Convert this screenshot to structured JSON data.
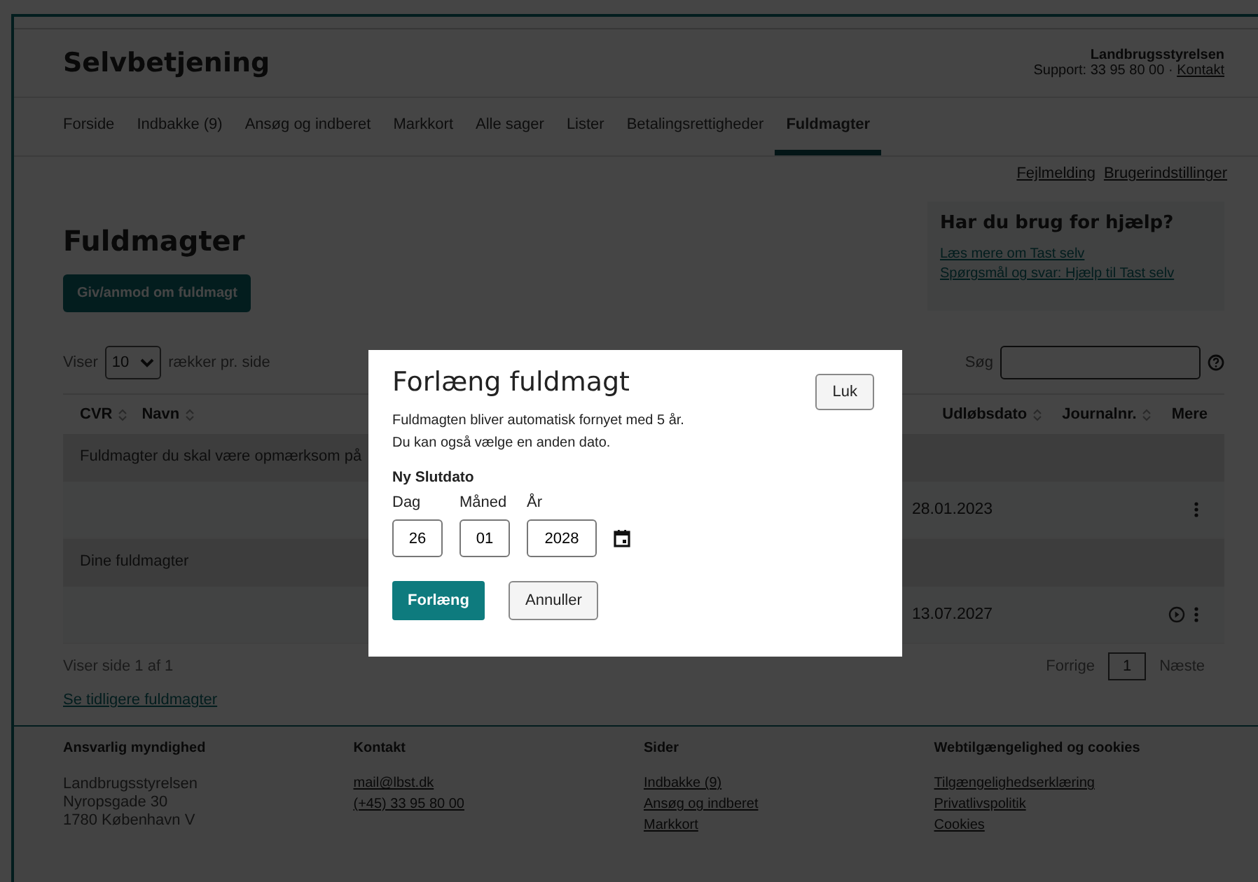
{
  "header": {
    "site_title": "Selvbetjening",
    "org": "Landbrugsstyrelsen",
    "support": "Support: 33 95 80 00 ·",
    "contact_link": "Kontakt"
  },
  "nav": [
    {
      "label": "Forside",
      "selected": false
    },
    {
      "label": "Indbakke (9)",
      "selected": false
    },
    {
      "label": "Ansøg og indberet",
      "selected": false
    },
    {
      "label": "Markkort",
      "selected": false
    },
    {
      "label": "Alle sager",
      "selected": false
    },
    {
      "label": "Lister",
      "selected": false
    },
    {
      "label": "Betalingsrettigheder",
      "selected": false
    },
    {
      "label": "Fuldmagter",
      "selected": true
    }
  ],
  "utility_links": [
    "Fejlmelding",
    "Brugerindstillinger"
  ],
  "page_title": "Fuldmagter",
  "primary_button": "Giv/anmod om fuldmagt",
  "help": {
    "title": "Har du brug for hjælp?",
    "links": [
      "Læs mere om Tast selv",
      "Spørgsmål og svar: Hjælp til Tast selv"
    ]
  },
  "page_size": {
    "prefix": "Viser",
    "value": "10",
    "suffix": "rækker pr. side"
  },
  "search": {
    "label": "Søg"
  },
  "table": {
    "left_columns": [
      "CVR",
      "Navn"
    ],
    "right_columns": [
      "Udløbsdato",
      "Journalnr."
    ],
    "actions_column": "Mere",
    "rows": [
      {
        "kind": "section",
        "text": "Fuldmagter du skal være opmærksom på"
      },
      {
        "kind": "data",
        "date": "28.01.2023",
        "play": false
      },
      {
        "kind": "section",
        "text": "Dine fuldmagter"
      },
      {
        "kind": "data",
        "date": "13.07.2027",
        "play": true
      }
    ]
  },
  "pagination": {
    "summary": "Viser side 1 af 1",
    "previous": "Forrige",
    "page": "1",
    "next": "Næste"
  },
  "earlier_link": "Se tidligere fuldmagter",
  "footer": [
    {
      "heading": "Ansvarlig myndighed",
      "kind": "text",
      "lines": [
        "Landbrugsstyrelsen",
        "Nyropsgade 30",
        "1780 København V"
      ]
    },
    {
      "heading": "Kontakt",
      "kind": "links",
      "lines": [
        "mail@lbst.dk",
        "(+45) 33 95 80 00"
      ]
    },
    {
      "heading": "Sider",
      "kind": "links",
      "lines": [
        "Indbakke (9)",
        "Ansøg og indberet",
        "Markkort"
      ]
    },
    {
      "heading": "Webtilgængelighed og cookies",
      "kind": "links",
      "lines": [
        "Tilgængelighedserklæring",
        "Privatlivspolitik",
        "Cookies"
      ]
    }
  ],
  "dialog": {
    "title": "Forlæng fuldmagt",
    "close": "Luk",
    "text": [
      "Fuldmagten bliver automatisk fornyet med 5 år.",
      "Du kan også vælge en anden dato."
    ],
    "date_heading": "Ny Slutdato",
    "fields": [
      {
        "label": "Dag",
        "value": "26"
      },
      {
        "label": "Måned",
        "value": "01"
      },
      {
        "label": "År",
        "value": "2028"
      }
    ],
    "confirm": "Forlæng",
    "cancel": "Annuller"
  }
}
